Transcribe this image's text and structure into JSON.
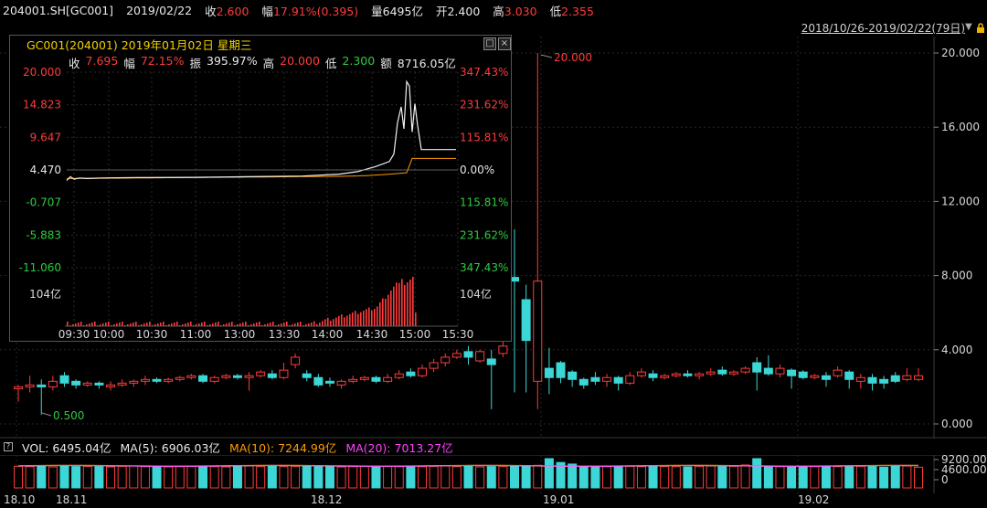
{
  "header": {
    "code": "204001.SH[GC001]",
    "date": "2019/02/22",
    "close_label": "收",
    "close_value": "2.600",
    "change_label": "幅",
    "change_value": "17.91%(0.395)",
    "volume_label": "量",
    "volume_value": "6495亿",
    "open_label": "开",
    "open_value": "2.400",
    "high_label": "高",
    "high_value": "3.030",
    "low_label": "低",
    "low_value": "2.355"
  },
  "date_range": "2018/10/26-2019/02/22(79日)",
  "main_chart": {
    "y_ticks": [
      "20.000",
      "16.000",
      "12.000",
      "8.000",
      "4.000",
      "0.000"
    ],
    "peak_label": "20.000",
    "low_label": "0.500",
    "date_ticks": [
      "18.10",
      "18.11",
      "18.12",
      "19.01",
      "19.02"
    ]
  },
  "popup": {
    "title": "GC001(204001) 2019年01月02日 星期三",
    "restore_btn": "□",
    "close_btn": "×",
    "stats": {
      "close_label": "收",
      "close_value": "7.695",
      "change_label": "幅",
      "change_value": "72.15%",
      "amp_label": "振",
      "amp_value": "395.97%",
      "high_label": "高",
      "high_value": "20.000",
      "low_label": "低",
      "low_value": "2.300",
      "amount_label": "额",
      "amount_value": "8716.05亿"
    },
    "left_ticks": [
      "20.000",
      "14.823",
      "9.647",
      "4.470",
      "-0.707",
      "-5.883",
      "-11.060"
    ],
    "right_ticks": [
      "347.43%",
      "231.62%",
      "115.81%",
      "0.00%",
      "115.81%",
      "231.62%",
      "347.43%"
    ],
    "vol_label_left": "104亿",
    "vol_label_right": "104亿",
    "time_ticks": [
      "09:30",
      "10:00",
      "10:30",
      "11:00",
      "13:00",
      "13:30",
      "14:00",
      "14:30",
      "15:00",
      "15:30"
    ]
  },
  "volume": {
    "vol_label": "VOL: 6495.04亿",
    "ma5_label": "MA(5): 6906.03亿",
    "ma10_label": "MA(10): 7244.99亿",
    "ma20_label": "MA(20): 7013.27亿",
    "y_ticks": [
      "9200.00",
      "4600.00",
      "0"
    ]
  },
  "colors": {
    "up": "#ff3b3b",
    "down": "#3cd6d6",
    "ma10": "#ff9a00",
    "ma20": "#ff40ff"
  },
  "chart_data": {
    "type": "candlestick",
    "ylim": [
      0,
      20
    ],
    "candles": [
      {
        "o": 1.9,
        "c": 2.0,
        "h": 2.1,
        "l": 1.2
      },
      {
        "o": 2.0,
        "c": 2.1,
        "h": 2.6,
        "l": 1.7
      },
      {
        "o": 2.1,
        "c": 2.0,
        "h": 2.4,
        "l": 0.5
      },
      {
        "o": 2.0,
        "c": 2.3,
        "h": 2.6,
        "l": 1.8
      },
      {
        "o": 2.6,
        "c": 2.2,
        "h": 2.8,
        "l": 2.0
      },
      {
        "o": 2.3,
        "c": 2.1,
        "h": 2.4,
        "l": 1.9
      },
      {
        "o": 2.1,
        "c": 2.2,
        "h": 2.3,
        "l": 2.0
      },
      {
        "o": 2.2,
        "c": 2.1,
        "h": 2.3,
        "l": 1.9
      },
      {
        "o": 2.0,
        "c": 2.1,
        "h": 2.3,
        "l": 1.8
      },
      {
        "o": 2.1,
        "c": 2.2,
        "h": 2.4,
        "l": 2.0
      },
      {
        "o": 2.2,
        "c": 2.3,
        "h": 2.4,
        "l": 2.0
      },
      {
        "o": 2.3,
        "c": 2.4,
        "h": 2.6,
        "l": 2.1
      },
      {
        "o": 2.4,
        "c": 2.3,
        "h": 2.5,
        "l": 2.2
      },
      {
        "o": 2.3,
        "c": 2.4,
        "h": 2.5,
        "l": 2.2
      },
      {
        "o": 2.4,
        "c": 2.5,
        "h": 2.6,
        "l": 2.3
      },
      {
        "o": 2.5,
        "c": 2.6,
        "h": 2.7,
        "l": 2.4
      },
      {
        "o": 2.6,
        "c": 2.3,
        "h": 2.7,
        "l": 2.2
      },
      {
        "o": 2.3,
        "c": 2.5,
        "h": 2.6,
        "l": 2.2
      },
      {
        "o": 2.5,
        "c": 2.6,
        "h": 2.7,
        "l": 2.4
      },
      {
        "o": 2.6,
        "c": 2.5,
        "h": 2.7,
        "l": 2.4
      },
      {
        "o": 2.5,
        "c": 2.6,
        "h": 2.8,
        "l": 1.8
      },
      {
        "o": 2.6,
        "c": 2.8,
        "h": 2.9,
        "l": 2.5
      },
      {
        "o": 2.7,
        "c": 2.5,
        "h": 2.9,
        "l": 2.4
      },
      {
        "o": 2.5,
        "c": 2.9,
        "h": 3.3,
        "l": 2.4
      },
      {
        "o": 3.2,
        "c": 3.6,
        "h": 3.8,
        "l": 3.0
      },
      {
        "o": 2.7,
        "c": 2.5,
        "h": 2.9,
        "l": 2.3
      },
      {
        "o": 2.5,
        "c": 2.1,
        "h": 2.7,
        "l": 2.0
      },
      {
        "o": 2.3,
        "c": 2.2,
        "h": 2.5,
        "l": 2.0
      },
      {
        "o": 2.1,
        "c": 2.3,
        "h": 2.4,
        "l": 1.9
      },
      {
        "o": 2.3,
        "c": 2.4,
        "h": 2.6,
        "l": 2.2
      },
      {
        "o": 2.4,
        "c": 2.5,
        "h": 2.6,
        "l": 2.3
      },
      {
        "o": 2.5,
        "c": 2.3,
        "h": 2.6,
        "l": 2.2
      },
      {
        "o": 2.3,
        "c": 2.5,
        "h": 2.7,
        "l": 2.2
      },
      {
        "o": 2.5,
        "c": 2.7,
        "h": 2.9,
        "l": 2.4
      },
      {
        "o": 2.8,
        "c": 2.6,
        "h": 3.0,
        "l": 2.5
      },
      {
        "o": 2.6,
        "c": 3.0,
        "h": 3.2,
        "l": 2.5
      },
      {
        "o": 3.0,
        "c": 3.3,
        "h": 3.5,
        "l": 2.8
      },
      {
        "o": 3.3,
        "c": 3.6,
        "h": 3.8,
        "l": 3.1
      },
      {
        "o": 3.6,
        "c": 3.8,
        "h": 4.0,
        "l": 3.5
      },
      {
        "o": 3.9,
        "c": 3.6,
        "h": 4.2,
        "l": 3.2
      },
      {
        "o": 3.4,
        "c": 3.9,
        "h": 4.0,
        "l": 3.3
      },
      {
        "o": 3.5,
        "c": 3.2,
        "h": 4.0,
        "l": 0.8
      },
      {
        "o": 3.8,
        "c": 4.2,
        "h": 4.5,
        "l": 3.6
      },
      {
        "o": 7.9,
        "c": 7.7,
        "h": 10.5,
        "l": 1.7
      },
      {
        "o": 6.7,
        "c": 4.5,
        "h": 7.5,
        "l": 1.7
      },
      {
        "o": 2.3,
        "c": 7.7,
        "h": 20.0,
        "l": 0.8
      },
      {
        "o": 3.0,
        "c": 2.5,
        "h": 4.1,
        "l": 1.6
      },
      {
        "o": 3.3,
        "c": 2.5,
        "h": 3.4,
        "l": 2.2
      },
      {
        "o": 2.8,
        "c": 2.4,
        "h": 2.9,
        "l": 2.0
      },
      {
        "o": 2.4,
        "c": 2.1,
        "h": 2.5,
        "l": 1.9
      },
      {
        "o": 2.5,
        "c": 2.3,
        "h": 2.8,
        "l": 2.1
      },
      {
        "o": 2.3,
        "c": 2.5,
        "h": 2.7,
        "l": 2.0
      },
      {
        "o": 2.5,
        "c": 2.2,
        "h": 2.6,
        "l": 1.8
      },
      {
        "o": 2.2,
        "c": 2.6,
        "h": 2.8,
        "l": 2.1
      },
      {
        "o": 2.6,
        "c": 2.8,
        "h": 3.0,
        "l": 2.5
      },
      {
        "o": 2.7,
        "c": 2.5,
        "h": 2.9,
        "l": 2.3
      },
      {
        "o": 2.5,
        "c": 2.6,
        "h": 2.7,
        "l": 2.4
      },
      {
        "o": 2.6,
        "c": 2.7,
        "h": 2.8,
        "l": 2.5
      },
      {
        "o": 2.7,
        "c": 2.6,
        "h": 2.9,
        "l": 2.5
      },
      {
        "o": 2.6,
        "c": 2.7,
        "h": 2.8,
        "l": 2.4
      },
      {
        "o": 2.7,
        "c": 2.8,
        "h": 3.0,
        "l": 2.6
      },
      {
        "o": 2.9,
        "c": 2.7,
        "h": 3.1,
        "l": 2.6
      },
      {
        "o": 2.7,
        "c": 2.8,
        "h": 2.9,
        "l": 2.6
      },
      {
        "o": 2.8,
        "c": 3.0,
        "h": 3.1,
        "l": 2.7
      },
      {
        "o": 3.3,
        "c": 2.8,
        "h": 3.6,
        "l": 1.8
      },
      {
        "o": 3.0,
        "c": 2.7,
        "h": 3.7,
        "l": 2.6
      },
      {
        "o": 2.7,
        "c": 3.0,
        "h": 3.2,
        "l": 2.5
      },
      {
        "o": 2.9,
        "c": 2.6,
        "h": 3.0,
        "l": 1.9
      },
      {
        "o": 2.8,
        "c": 2.5,
        "h": 2.9,
        "l": 2.4
      },
      {
        "o": 2.5,
        "c": 2.6,
        "h": 2.7,
        "l": 2.4
      },
      {
        "o": 2.6,
        "c": 2.4,
        "h": 2.8,
        "l": 2.0
      },
      {
        "o": 2.6,
        "c": 2.9,
        "h": 3.1,
        "l": 2.5
      },
      {
        "o": 2.8,
        "c": 2.4,
        "h": 2.9,
        "l": 1.9
      },
      {
        "o": 2.3,
        "c": 2.5,
        "h": 2.7,
        "l": 1.9
      },
      {
        "o": 2.5,
        "c": 2.2,
        "h": 2.7,
        "l": 1.8
      },
      {
        "o": 2.4,
        "c": 2.2,
        "h": 2.6,
        "l": 1.9
      },
      {
        "o": 2.6,
        "c": 2.3,
        "h": 2.8,
        "l": 2.2
      },
      {
        "o": 2.4,
        "c": 2.6,
        "h": 3.0,
        "l": 2.3
      },
      {
        "o": 2.4,
        "c": 2.6,
        "h": 3.0,
        "l": 2.3
      }
    ],
    "volume": [
      6800,
      6700,
      6900,
      6600,
      6800,
      6700,
      6800,
      6700,
      6600,
      6800,
      6900,
      6700,
      6800,
      6600,
      6700,
      6800,
      6800,
      6700,
      6600,
      6700,
      6900,
      6700,
      6800,
      6700,
      6800,
      6900,
      6700,
      6800,
      6600,
      6700,
      6900,
      6700,
      6800,
      6700,
      6800,
      6700,
      6800,
      6900,
      6700,
      6800,
      6600,
      6700,
      6800,
      6900,
      7000,
      7100,
      9200,
      8000,
      7500,
      6700,
      6800,
      6700,
      6600,
      6800,
      6700,
      6900,
      6800,
      6700,
      6600,
      6800,
      6900,
      6700,
      6800,
      7200,
      9200,
      6800,
      6700,
      6600,
      6800,
      6700,
      6800,
      6700,
      6600,
      6800,
      6700,
      6500,
      6800,
      6900,
      6495
    ],
    "intraday": {
      "xlabel_ticks": [
        "09:30",
        "10:00",
        "10:30",
        "11:00",
        "13:00",
        "13:30",
        "14:00",
        "14:30",
        "15:00",
        "15:30"
      ],
      "ylim": [
        -11.06,
        20.0
      ],
      "prev_close": 4.47
    }
  }
}
